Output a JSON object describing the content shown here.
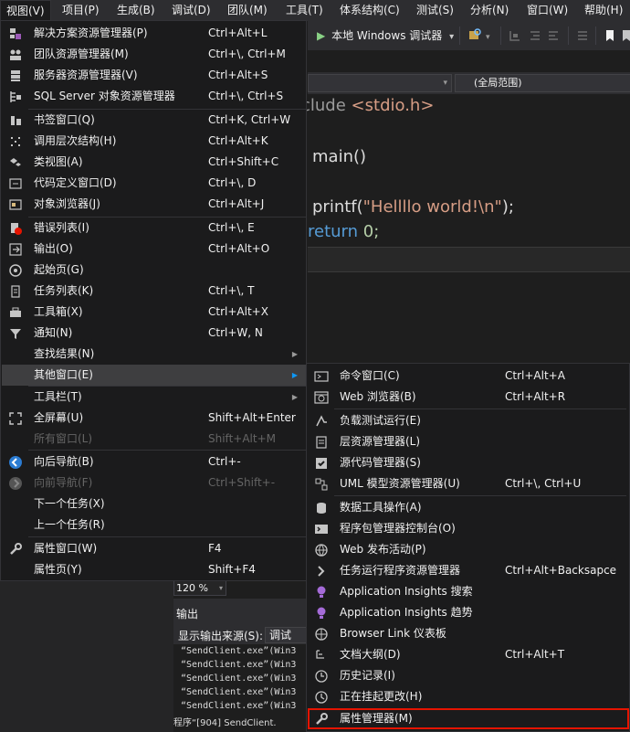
{
  "menubar": {
    "items": [
      {
        "label": "视图(V)"
      },
      {
        "label": "项目(P)"
      },
      {
        "label": "生成(B)"
      },
      {
        "label": "调试(D)"
      },
      {
        "label": "团队(M)"
      },
      {
        "label": "工具(T)"
      },
      {
        "label": "体系结构(C)"
      },
      {
        "label": "测试(S)"
      },
      {
        "label": "分析(N)"
      },
      {
        "label": "窗口(W)"
      },
      {
        "label": "帮助(H)"
      }
    ]
  },
  "toolbar": {
    "debug_label": "本地 Windows 调试器",
    "debug_dropdown": "▾"
  },
  "scope": {
    "left": "",
    "right": "(全局范围)"
  },
  "editor": {
    "line1_kw": "clude",
    "line1_hdr": "<stdio.h>",
    "line2": "main()",
    "line3_fn": "printf(",
    "line3_str": "\"Hellllo world!\\n\"",
    "line3_end": ");",
    "line4_kw": "return",
    "line4_val": "0;"
  },
  "zoom": {
    "value": "120 %"
  },
  "output": {
    "title": "输出",
    "source_label": "显示输出来源(S):",
    "source_value": "调试",
    "lines": [
      "“SendClient.exe”(Win3",
      "“SendClient.exe”(Win3",
      "“SendClient.exe”(Win3",
      "“SendClient.exe”(Win3",
      "“SendClient.exe”(Win3",
      "程序“[904] SendClient."
    ]
  },
  "view_menu": {
    "items": [
      {
        "label": "解决方案资源管理器(P)",
        "shortcut": "Ctrl+Alt+L",
        "icon": "solution-explorer-icon"
      },
      {
        "label": "团队资源管理器(M)",
        "shortcut": "Ctrl+\\, Ctrl+M",
        "icon": "team-explorer-icon"
      },
      {
        "label": "服务器资源管理器(V)",
        "shortcut": "Ctrl+Alt+S",
        "icon": "server-explorer-icon"
      },
      {
        "label": "SQL Server 对象资源管理器",
        "shortcut": "Ctrl+\\, Ctrl+S",
        "icon": "sql-server-icon"
      },
      {
        "label": "书签窗口(Q)",
        "shortcut": "Ctrl+K, Ctrl+W",
        "icon": "bookmark-icon"
      },
      {
        "label": "调用层次结构(H)",
        "shortcut": "Ctrl+Alt+K",
        "icon": "call-hierarchy-icon"
      },
      {
        "label": "类视图(A)",
        "shortcut": "Ctrl+Shift+C",
        "icon": "class-view-icon"
      },
      {
        "label": "代码定义窗口(D)",
        "shortcut": "Ctrl+\\, D",
        "icon": "code-definition-icon"
      },
      {
        "label": "对象浏览器(J)",
        "shortcut": "Ctrl+Alt+J",
        "icon": "object-browser-icon"
      },
      {
        "label": "错误列表(I)",
        "shortcut": "Ctrl+\\, E",
        "icon": "error-list-icon"
      },
      {
        "label": "输出(O)",
        "shortcut": "Ctrl+Alt+O",
        "icon": "output-icon"
      },
      {
        "label": "起始页(G)",
        "shortcut": "",
        "icon": "start-page-icon"
      },
      {
        "label": "任务列表(K)",
        "shortcut": "Ctrl+\\, T",
        "icon": "task-list-icon"
      },
      {
        "label": "工具箱(X)",
        "shortcut": "Ctrl+Alt+X",
        "icon": "toolbox-icon"
      },
      {
        "label": "通知(N)",
        "shortcut": "Ctrl+W, N",
        "icon": "notifications-icon"
      },
      {
        "label": "查找结果(N)",
        "shortcut": "",
        "icon": ""
      },
      {
        "label": "其他窗口(E)",
        "shortcut": "",
        "icon": ""
      },
      {
        "label": "工具栏(T)",
        "shortcut": "",
        "icon": ""
      },
      {
        "label": "全屏幕(U)",
        "shortcut": "Shift+Alt+Enter",
        "icon": "fullscreen-icon"
      },
      {
        "label": "所有窗口(L)",
        "shortcut": "Shift+Alt+M",
        "icon": ""
      },
      {
        "label": "向后导航(B)",
        "shortcut": "Ctrl+-",
        "icon": "navigate-back-icon"
      },
      {
        "label": "向前导航(F)",
        "shortcut": "Ctrl+Shift+-",
        "icon": "navigate-forward-icon"
      },
      {
        "label": "下一个任务(X)",
        "shortcut": "",
        "icon": ""
      },
      {
        "label": "上一个任务(R)",
        "shortcut": "",
        "icon": ""
      },
      {
        "label": "属性窗口(W)",
        "shortcut": "F4",
        "icon": "properties-wrench-icon"
      },
      {
        "label": "属性页(Y)",
        "shortcut": "Shift+F4",
        "icon": ""
      }
    ]
  },
  "other_windows_menu": {
    "items": [
      {
        "label": "命令窗口(C)",
        "shortcut": "Ctrl+Alt+A",
        "icon": "command-window-icon"
      },
      {
        "label": "Web 浏览器(B)",
        "shortcut": "Ctrl+Alt+R",
        "icon": "web-browser-icon"
      },
      {
        "label": "负载测试运行(E)",
        "shortcut": "",
        "icon": "load-test-icon"
      },
      {
        "label": "层资源管理器(L)",
        "shortcut": "",
        "icon": "layer-explorer-icon"
      },
      {
        "label": "源代码管理器(S)",
        "shortcut": "",
        "icon": "source-control-icon"
      },
      {
        "label": "UML 模型资源管理器(U)",
        "shortcut": "Ctrl+\\, Ctrl+U",
        "icon": "uml-explorer-icon"
      },
      {
        "label": "数据工具操作(A)",
        "shortcut": "",
        "icon": "data-tools-icon"
      },
      {
        "label": "程序包管理器控制台(O)",
        "shortcut": "",
        "icon": "package-manager-icon"
      },
      {
        "label": "Web 发布活动(P)",
        "shortcut": "",
        "icon": "web-publish-icon"
      },
      {
        "label": "任务运行程序资源管理器",
        "shortcut": "Ctrl+Alt+Backsapce",
        "icon": "task-runner-icon"
      },
      {
        "label": "Application Insights 搜索",
        "shortcut": "",
        "icon": "insights-search-icon"
      },
      {
        "label": "Application Insights 趋势",
        "shortcut": "",
        "icon": "insights-trends-icon"
      },
      {
        "label": "Browser Link 仪表板",
        "shortcut": "",
        "icon": "browser-link-icon"
      },
      {
        "label": "文档大纲(D)",
        "shortcut": "Ctrl+Alt+T",
        "icon": "document-outline-icon"
      },
      {
        "label": "历史记录(I)",
        "shortcut": "",
        "icon": "history-icon"
      },
      {
        "label": "正在挂起更改(H)",
        "shortcut": "",
        "icon": "pending-changes-icon"
      },
      {
        "label": "属性管理器(M)",
        "shortcut": "",
        "icon": "property-manager-icon"
      }
    ]
  },
  "colors": {
    "menu_bg": "#1b1b1c",
    "highlight": "#3e3e40",
    "accent_red": "#e51400",
    "keyword": "#569cd6",
    "string": "#d69d85",
    "include": "#d69d85"
  }
}
